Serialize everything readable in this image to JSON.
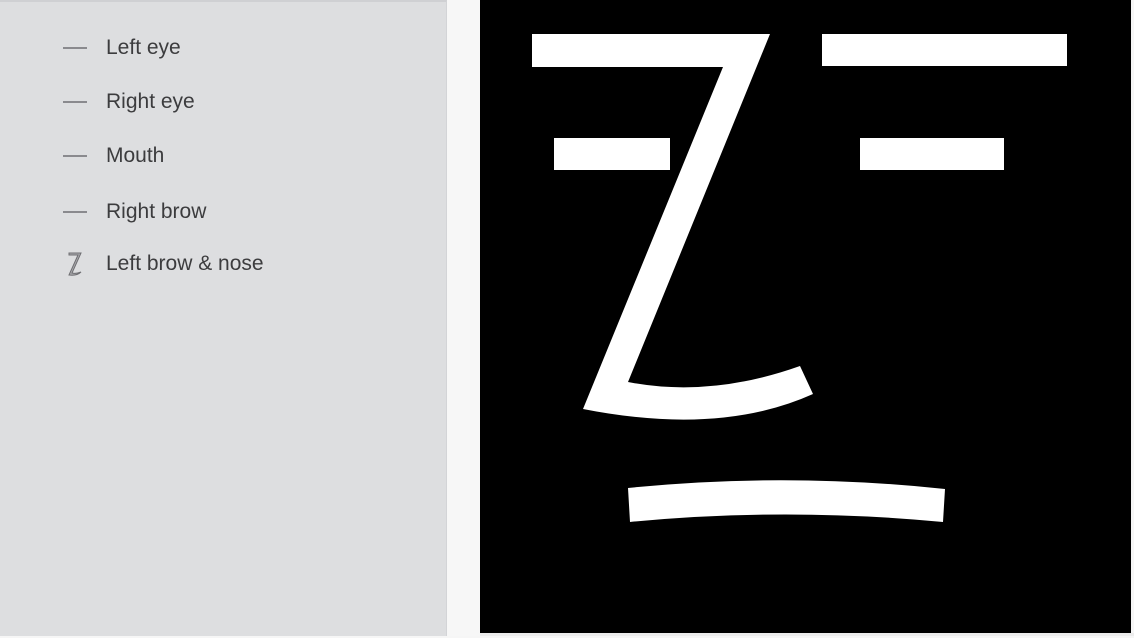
{
  "layers_panel": {
    "items": [
      {
        "label": "Left eye",
        "icon": "line-shape-icon"
      },
      {
        "label": "Right eye",
        "icon": "line-shape-icon"
      },
      {
        "label": "Mouth",
        "icon": "line-shape-icon"
      },
      {
        "label": "Right brow",
        "icon": "line-shape-icon"
      },
      {
        "label": "Left brow & nose",
        "icon": "zigzag-shape-icon"
      }
    ]
  },
  "canvas": {
    "background": "#000000",
    "shape_color": "#ffffff",
    "shapes": [
      "left-brow-and-nose-shape",
      "right-brow-shape",
      "left-eye-shape",
      "right-eye-shape",
      "mouth-shape"
    ]
  },
  "colors": {
    "sidebar_background": "#dddee0",
    "label_text": "#3c3c3e",
    "icon_stroke": "#6e6e72"
  }
}
